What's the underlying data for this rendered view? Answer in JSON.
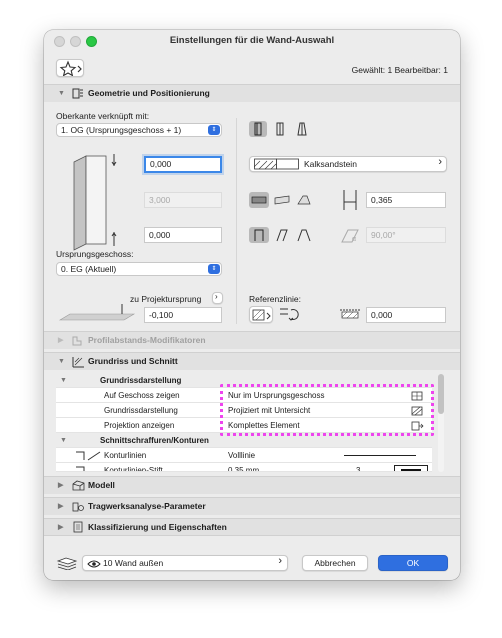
{
  "window": {
    "title": "Einstellungen für die Wand-Auswahl",
    "selection_info": "Gewählt: 1 Bearbeitbar: 1"
  },
  "geometry": {
    "section_title": "Geometrie und Positionierung",
    "top_link_label": "Oberkante verknüpft mit:",
    "top_link_value": "1. OG (Ursprungsgeschoss + 1)",
    "top_offset": "0,000",
    "height": "3,000",
    "bottom_offset": "0,000",
    "home_story_label": "Ursprungsgeschoss:",
    "home_story_value": "0. EG (Aktuell)",
    "to_project_zero_label": "zu Projektursprung",
    "project_zero_value": "-0,100",
    "material": "Kalksandstein",
    "thickness": "0,365",
    "angle": "90,00°",
    "reference_line_label": "Referenzlinie:",
    "reference_offset": "0,000"
  },
  "sections": {
    "profile_modifiers": "Profilabstands-Modifikatoren",
    "floor_plan": "Grundriss und Schnitt",
    "model": "Modell",
    "structural": "Tragwerksanalyse-Parameter",
    "classification": "Klassifizierung und Eigenschaften"
  },
  "floor_plan_table": {
    "group1": "Grundrissdarstellung",
    "rows": [
      {
        "label": "Auf Geschoss zeigen",
        "value": "Nur im Ursprungsgeschoss"
      },
      {
        "label": "Grundrissdarstellung",
        "value": "Projiziert mit Untersicht"
      },
      {
        "label": "Projektion anzeigen",
        "value": "Komplettes Element"
      }
    ],
    "group2": "Schnittschraffuren/Konturen",
    "contour_label": "Konturlinien",
    "contour_value": "Volllinie",
    "pen_label": "Konturlinien-Stift",
    "pen_value": "0,35 mm",
    "pen_number": "3"
  },
  "footer": {
    "layer": "10 Wand außen",
    "cancel": "Abbrechen",
    "ok": "OK"
  },
  "colors": {
    "accent": "#2f6fe0",
    "highlight": "#ee44ee"
  }
}
